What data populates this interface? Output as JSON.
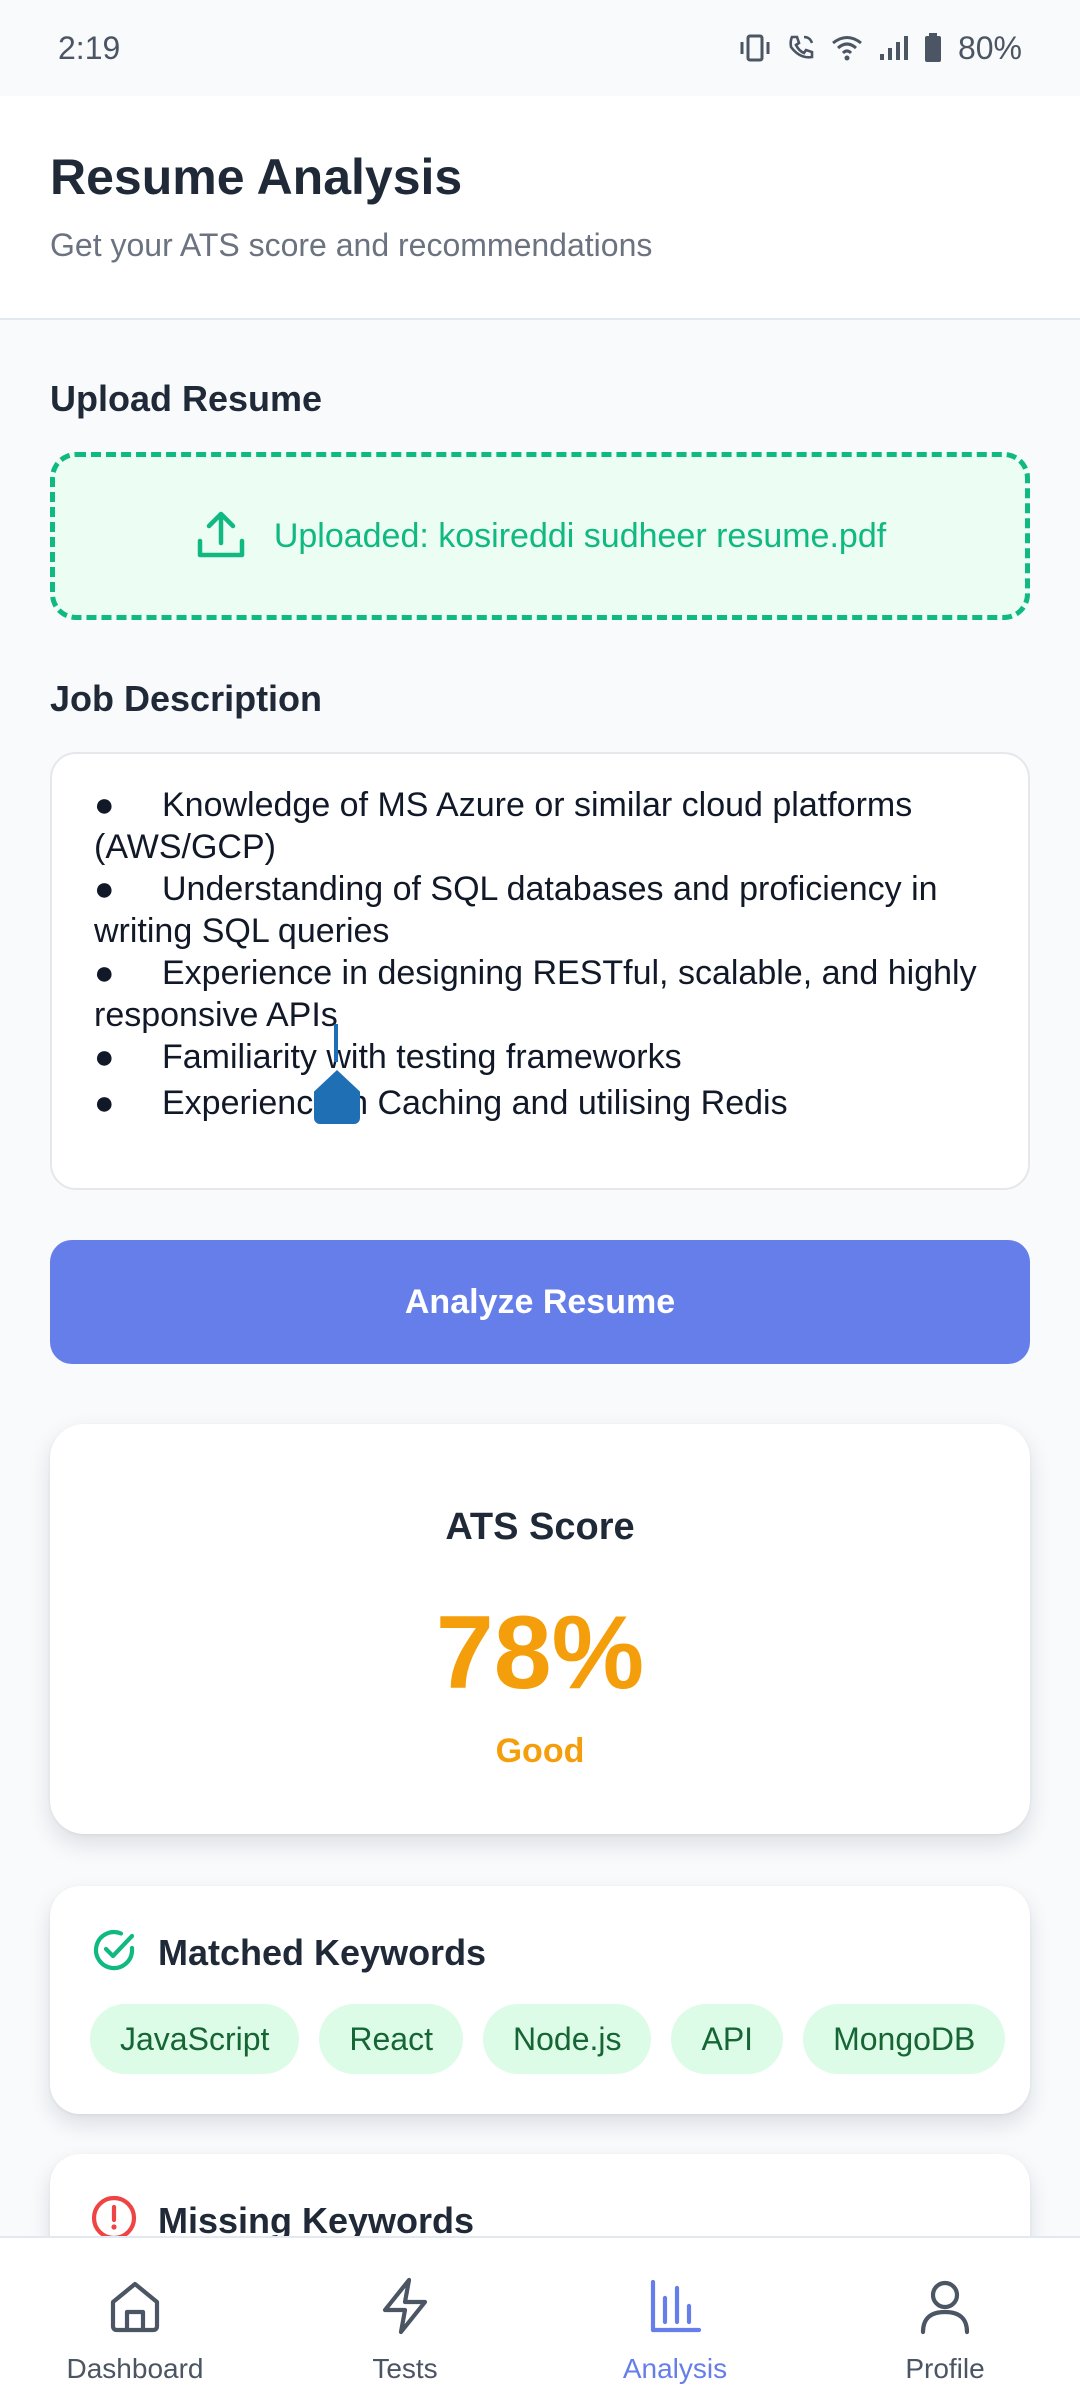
{
  "status_bar": {
    "time": "2:19",
    "battery": "80%",
    "icons": [
      "vibrate-icon",
      "wifi-calling-icon",
      "wifi-icon",
      "signal-icon",
      "battery-icon"
    ]
  },
  "header": {
    "title": "Resume Analysis",
    "subtitle": "Get your ATS score and recommendations"
  },
  "upload": {
    "label": "Upload Resume",
    "status_text": "Uploaded: kosireddi sudheer resume.pdf",
    "icon": "upload-icon",
    "color": "#10b981"
  },
  "job_description": {
    "label": "Job Description",
    "lines": [
      {
        "bullet": "●",
        "text": "Knowledge of MS Azure or similar cloud platforms",
        "cont": "(AWS/GCP)"
      },
      {
        "bullet": "●",
        "text": "Understanding of SQL databases and proficiency in",
        "cont": "writing SQL queries"
      },
      {
        "bullet": "●",
        "text": "Experience in designing RESTful, scalable, and highly",
        "cont": "responsive APIs"
      },
      {
        "bullet": "●",
        "text": "Familiarity with testing frameworks",
        "cont": ""
      },
      {
        "bullet": "●",
        "text": "Experience in Caching and utilising Redis",
        "cont": ""
      }
    ]
  },
  "analyze_button": {
    "label": "Analyze Resume",
    "color": "#667eea"
  },
  "ats": {
    "title": "ATS Score",
    "score": "78%",
    "rating": "Good",
    "color": "#f59e0b"
  },
  "matched_keywords": {
    "title": "Matched Keywords",
    "icon": "check-circle-icon",
    "keywords": [
      "JavaScript",
      "React",
      "Node.js",
      "API",
      "MongoDB"
    ]
  },
  "missing_keywords": {
    "title": "Missing Keywords",
    "icon": "alert-circle-icon"
  },
  "bottom_nav": {
    "items": [
      {
        "label": "Dashboard",
        "icon": "home-icon",
        "active": false
      },
      {
        "label": "Tests",
        "icon": "lightning-icon",
        "active": false
      },
      {
        "label": "Analysis",
        "icon": "bar-chart-icon",
        "active": true
      },
      {
        "label": "Profile",
        "icon": "user-icon",
        "active": false
      }
    ],
    "active_color": "#667eea"
  }
}
